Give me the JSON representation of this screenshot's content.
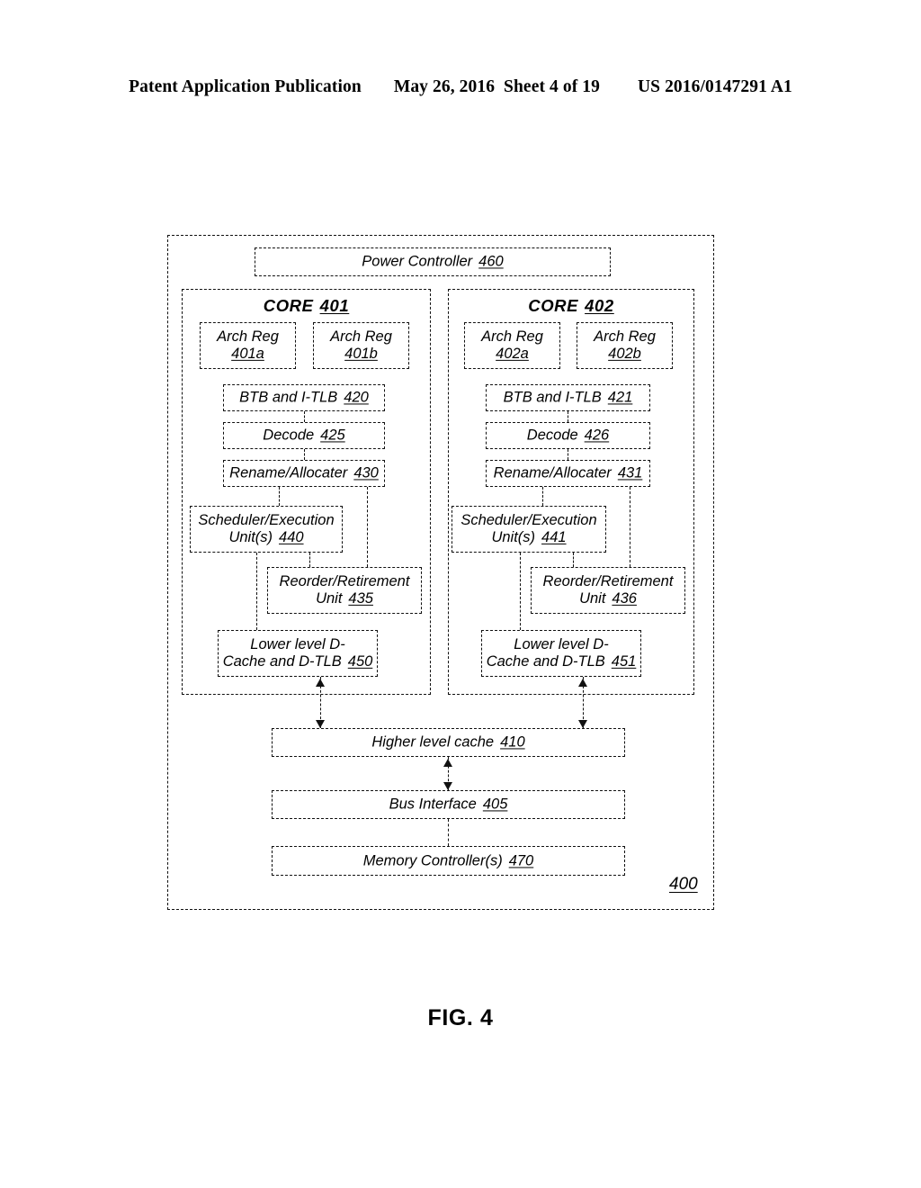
{
  "header": {
    "publication": "Patent Application Publication",
    "date": "May 26, 2016",
    "sheet": "Sheet 4 of 19",
    "patent_number": "US 2016/0147291 A1"
  },
  "figure": {
    "caption": "FIG. 4",
    "system_ref": "400"
  },
  "diagram": {
    "power_controller": {
      "label": "Power Controller",
      "ref": "460"
    },
    "cores": [
      {
        "title": "CORE",
        "ref": "401",
        "arch_regs": [
          {
            "line1": "Arch Reg",
            "ref": "401a"
          },
          {
            "line1": "Arch Reg",
            "ref": "401b"
          }
        ],
        "btb": {
          "label": "BTB and I-TLB",
          "ref": "420"
        },
        "decode": {
          "label": "Decode",
          "ref": "425"
        },
        "rename": {
          "label": "Rename/Allocater",
          "ref": "430"
        },
        "scheduler": {
          "line1": "Scheduler/Execution",
          "line2": "Unit(s)",
          "ref": "440"
        },
        "reorder": {
          "line1": "Reorder/Retirement",
          "line2": "Unit",
          "ref": "435"
        },
        "dcache": {
          "line1": "Lower level D-",
          "line2": "Cache and D-TLB",
          "ref": "450"
        }
      },
      {
        "title": "CORE",
        "ref": "402",
        "arch_regs": [
          {
            "line1": "Arch Reg",
            "ref": "402a"
          },
          {
            "line1": "Arch Reg",
            "ref": "402b"
          }
        ],
        "btb": {
          "label": "BTB and I-TLB",
          "ref": "421"
        },
        "decode": {
          "label": "Decode",
          "ref": "426"
        },
        "rename": {
          "label": "Rename/Allocater",
          "ref": "431"
        },
        "scheduler": {
          "line1": "Scheduler/Execution",
          "line2": "Unit(s)",
          "ref": "441"
        },
        "reorder": {
          "line1": "Reorder/Retirement",
          "line2": "Unit",
          "ref": "436"
        },
        "dcache": {
          "line1": "Lower level D-",
          "line2": "Cache and D-TLB",
          "ref": "451"
        }
      }
    ],
    "higher_level_cache": {
      "label": "Higher level cache",
      "ref": "410"
    },
    "bus_interface": {
      "label": "Bus Interface",
      "ref": "405"
    },
    "memory_controller": {
      "label": "Memory Controller(s)",
      "ref": "470"
    }
  }
}
